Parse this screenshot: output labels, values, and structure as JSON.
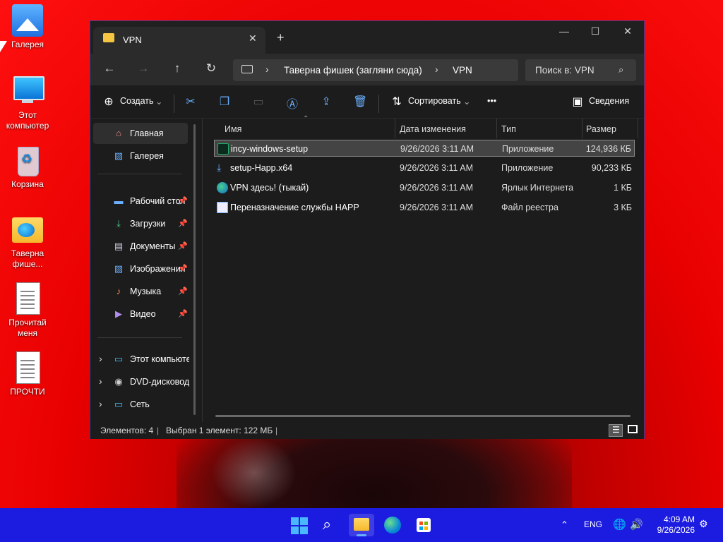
{
  "desktop": {
    "icons": [
      {
        "label": "Галерея",
        "icon": "gallery-icon"
      },
      {
        "label": "Этот компьютер",
        "icon": "computer-icon"
      },
      {
        "label": "Корзина",
        "icon": "recycle-bin-icon"
      },
      {
        "label": "Таверна фише...",
        "icon": "folder-icon"
      },
      {
        "label": "Прочитай меня",
        "icon": "text-document-icon"
      },
      {
        "label": "ПРОЧТИ",
        "icon": "text-document-icon"
      }
    ]
  },
  "window": {
    "tab_title": "VPN",
    "tab_close": "✕",
    "new_tab": "+",
    "controls": {
      "minimize": "—",
      "maximize": "☐",
      "close": "✕"
    },
    "address": {
      "crumbs": [
        "Таверна фишек (загляни сюда)",
        "VPN"
      ]
    },
    "search_placeholder": "Поиск в: VPN",
    "toolbar": {
      "create": "Создать",
      "sort": "Сортировать",
      "more": "•••",
      "details": "Сведения"
    },
    "sidebar": {
      "items": [
        {
          "label": "Главная",
          "active": true
        },
        {
          "label": "Галерея"
        },
        {
          "label": "Рабочий стол",
          "pinned": true
        },
        {
          "label": "Загрузки",
          "pinned": true
        },
        {
          "label": "Документы",
          "pinned": true
        },
        {
          "label": "Изображения",
          "pinned": true
        },
        {
          "label": "Музыка",
          "pinned": true
        },
        {
          "label": "Видео",
          "pinned": true
        },
        {
          "label": "Этот компьютер",
          "expandable": true
        },
        {
          "label": "DVD-дисковод (",
          "expandable": true
        },
        {
          "label": "Сеть",
          "expandable": true
        }
      ]
    },
    "columns": {
      "name": "Имя",
      "date": "Дата изменения",
      "type": "Тип",
      "size": "Размер"
    },
    "files": [
      {
        "name": "incy-windows-setup",
        "date": "9/26/2026 3:11 AM",
        "type": "Приложение",
        "size": "124,936 КБ",
        "selected": true
      },
      {
        "name": "setup-Happ.x64",
        "date": "9/26/2026 3:11 AM",
        "type": "Приложение",
        "size": "90,233 КБ"
      },
      {
        "name": "VPN здесь! (тыкай)",
        "date": "9/26/2026 3:11 AM",
        "type": "Ярлык Интернета",
        "size": "1 КБ"
      },
      {
        "name": "Переназначение службы HAPP",
        "date": "9/26/2026 3:11 AM",
        "type": "Файл реестра",
        "size": "3 КБ"
      }
    ],
    "status": {
      "count": "Элементов: 4",
      "selection": "Выбран 1 элемент: 122 МБ"
    }
  },
  "taskbar": {
    "lang": "ENG",
    "time": "4:09 AM",
    "date": "9/26/2026"
  }
}
